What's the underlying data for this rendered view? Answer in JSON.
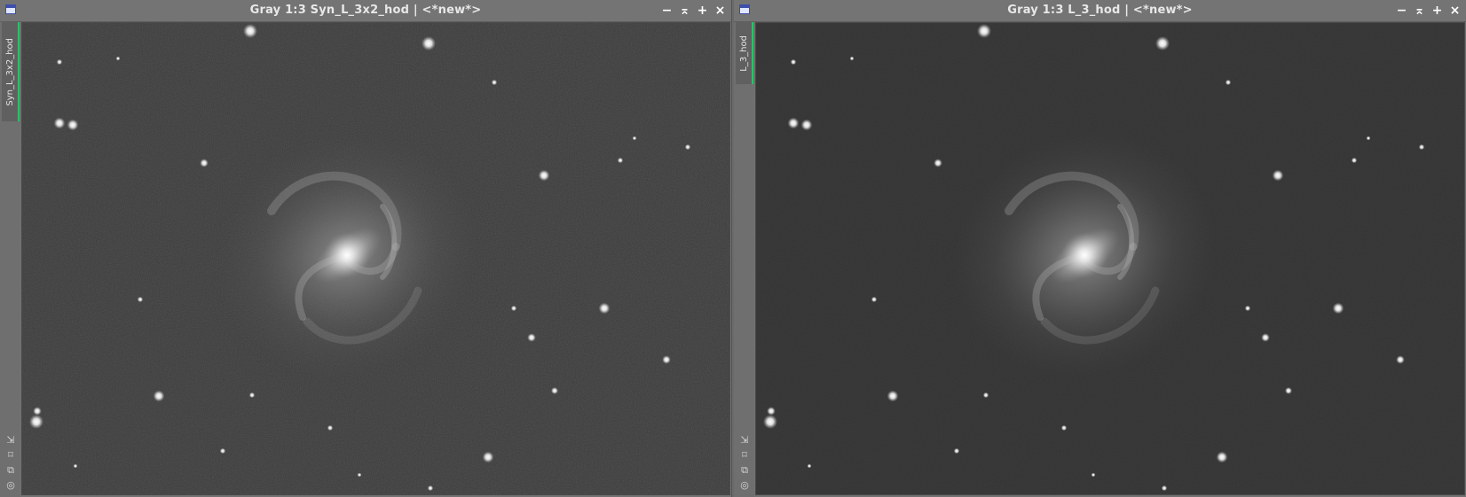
{
  "windows": [
    {
      "title": "Gray 1:3 Syn_L_3x2_hod | <*new*>",
      "tab_label": "Syn_L_3x2_hod",
      "controls": {
        "minimize": "−",
        "shade": "⌅",
        "maximize": "+",
        "close": "×"
      },
      "tools": [
        "⇲",
        "⌑",
        "⧉",
        "◎"
      ]
    },
    {
      "title": "Gray 1:3 L_3_hod | <*new*>",
      "tab_label": "L_3_hod",
      "controls": {
        "minimize": "−",
        "shade": "⌅",
        "maximize": "+",
        "close": "×"
      },
      "tools": [
        "⇲",
        "⌑",
        "⧉",
        "◎"
      ]
    }
  ],
  "colors": {
    "background_left": "#3a3a3a",
    "background_right": "#333333",
    "tab_accent": "#2ec06a",
    "window_icon": "#3d4fae"
  }
}
